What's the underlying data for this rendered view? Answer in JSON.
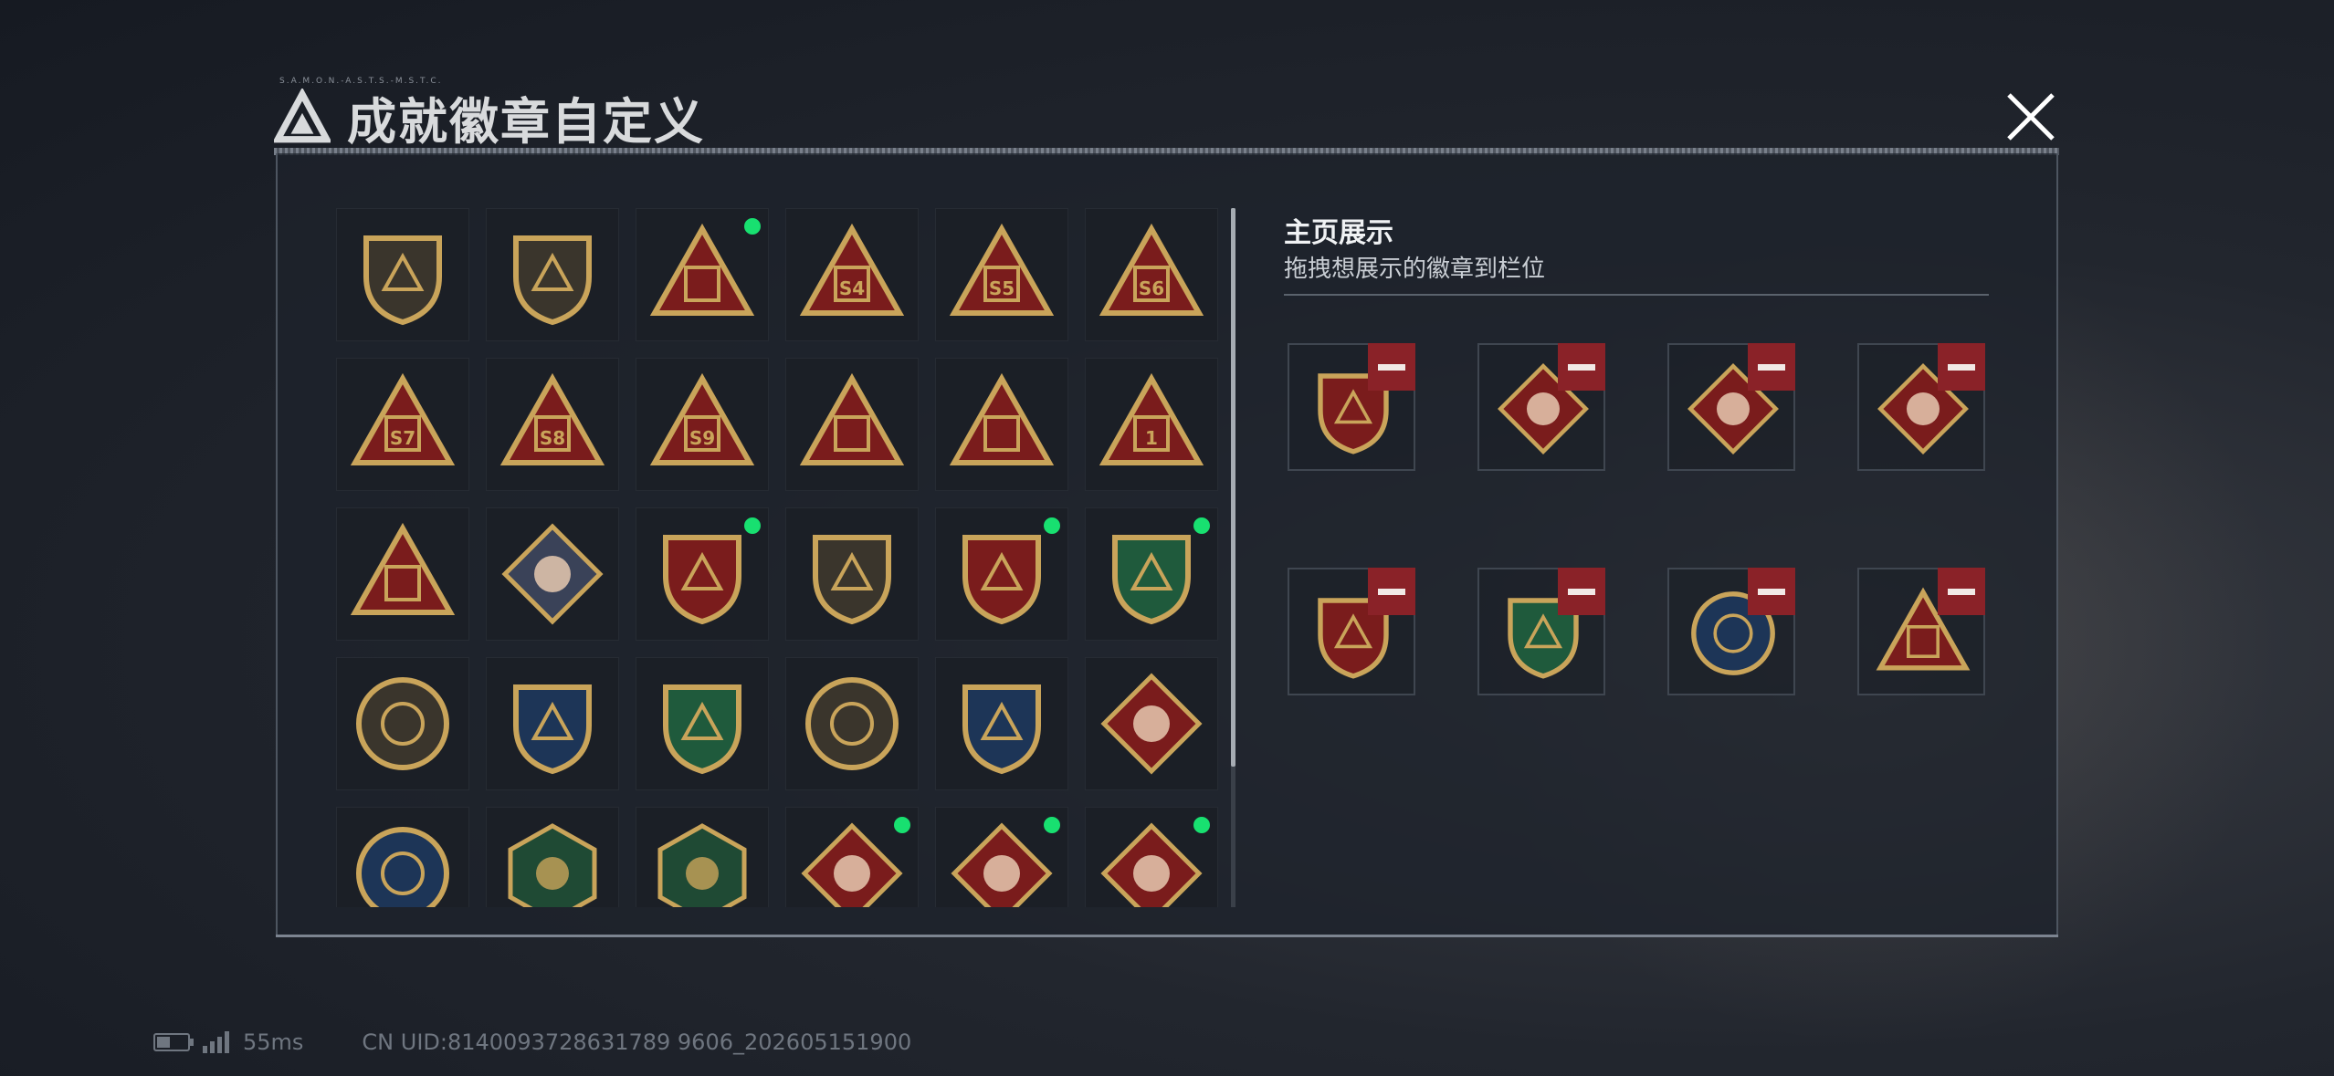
{
  "header": {
    "title": "成就徽章自定义",
    "tiny_label": "S.A.M.O.N.-A.S.T.S.-M.S.T.C."
  },
  "colors": {
    "accent_green": "#18e070",
    "remove_red": "#8a2228",
    "gold": "#c9a45a"
  },
  "grid": {
    "badges": [
      {
        "icon": "shield-a-icon",
        "new": false
      },
      {
        "icon": "helicopter-shield-icon",
        "new": false
      },
      {
        "icon": "satellite-triangle-icon",
        "new": true
      },
      {
        "icon": "s4-triangle-icon",
        "new": false,
        "text": "S4"
      },
      {
        "icon": "s5-triangle-icon",
        "new": false,
        "text": "S5"
      },
      {
        "icon": "s6-triangle-icon",
        "new": false,
        "text": "S6"
      },
      {
        "icon": "s7-triangle-icon",
        "new": false,
        "text": "S7"
      },
      {
        "icon": "s8-triangle-icon",
        "new": false,
        "text": "S8"
      },
      {
        "icon": "s9-triangle-icon",
        "new": false,
        "text": "S9"
      },
      {
        "icon": "soldier-triangle-icon",
        "new": false
      },
      {
        "icon": "boat-triangle-icon",
        "new": false
      },
      {
        "icon": "number-one-triangle-icon",
        "new": false,
        "text": "1"
      },
      {
        "icon": "squad-triangle-icon",
        "new": false
      },
      {
        "icon": "rose-diamond-icon",
        "new": false
      },
      {
        "icon": "star-emblem-icon",
        "new": true
      },
      {
        "icon": "chevron-shield-icon",
        "new": false
      },
      {
        "icon": "winged-shield-icon",
        "new": true
      },
      {
        "icon": "green-gem-shield-icon",
        "new": true
      },
      {
        "icon": "clover-round-icon",
        "new": false
      },
      {
        "icon": "crosshair-rifle-blue-icon",
        "new": false
      },
      {
        "icon": "crosshair-rifle-green-icon",
        "new": false
      },
      {
        "icon": "rifle-round-icon",
        "new": false
      },
      {
        "icon": "crossed-rifles-gold-icon",
        "new": false
      },
      {
        "icon": "wolf-diamond-icon",
        "new": false
      },
      {
        "icon": "eagle-round-icon",
        "new": false
      },
      {
        "icon": "hornet-hexagon-icon",
        "new": false
      },
      {
        "icon": "medic-hexagon-icon",
        "new": false
      },
      {
        "icon": "dragon-diamond-icon",
        "new": true
      },
      {
        "icon": "dragon-diamond-icon",
        "new": true
      },
      {
        "icon": "runner-diamond-icon",
        "new": true
      }
    ]
  },
  "showcase": {
    "title": "主页展示",
    "subtitle": "拖拽想展示的徽章到栏位",
    "slots": [
      {
        "icon": "winged-shield-icon"
      },
      {
        "icon": "dragon-diamond-icon"
      },
      {
        "icon": "runner-diamond-icon"
      },
      {
        "icon": "dragon-diamond-icon"
      },
      {
        "icon": "star-emblem-icon"
      },
      {
        "icon": "green-gem-shield-icon"
      },
      {
        "icon": "lynx-round-icon"
      },
      {
        "icon": "satellite-triangle-icon"
      }
    ]
  },
  "footer": {
    "ping": "55ms",
    "uid": "CN UID:8140093728631789 9606_202605151900"
  }
}
